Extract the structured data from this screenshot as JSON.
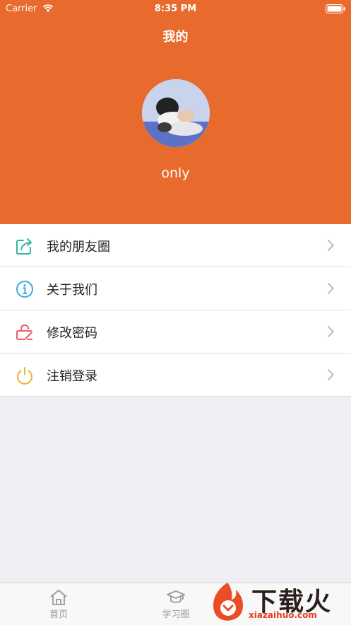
{
  "status_bar": {
    "carrier": "Carrier",
    "time": "8:35 PM"
  },
  "header": {
    "title": "我的",
    "username": "only"
  },
  "menu": [
    {
      "label": "我的朋友圈",
      "icon": "share-icon",
      "color": "#2fb7a8"
    },
    {
      "label": "关于我们",
      "icon": "info-icon",
      "color": "#3aa8e8"
    },
    {
      "label": "修改密码",
      "icon": "lock-icon",
      "color": "#ee5a6a"
    },
    {
      "label": "注销登录",
      "icon": "power-icon",
      "color": "#f0b33a"
    }
  ],
  "tabbar": [
    {
      "label": "首页",
      "icon": "home-icon"
    },
    {
      "label": "学习圈",
      "icon": "graduation-cap-icon"
    }
  ],
  "watermark": {
    "text": "下载火",
    "sub": "xiazaihuo.com"
  },
  "colors": {
    "header": "#e86a2d",
    "background": "#efeff4"
  }
}
